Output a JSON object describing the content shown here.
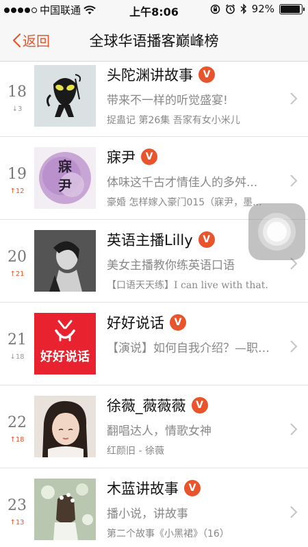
{
  "status": {
    "carrier": "中国联通",
    "time": "上午8:06",
    "battery": "92%",
    "battery_level": 0.92
  },
  "nav": {
    "back_label": "返回",
    "title": "全球华语播客巅峰榜"
  },
  "accent": "#e8542c",
  "items": [
    {
      "rank": "18",
      "trend": "↓3",
      "trend_dir": "down",
      "name": "头陀渊讲故事",
      "desc": "带来不一样的听觉盛宴!",
      "latest": "捉蛊记 第26集 吾家有女小米儿"
    },
    {
      "rank": "19",
      "trend": "↑12",
      "trend_dir": "up",
      "name": "寐尹",
      "desc": "体味这千古才情佳人的多舛...",
      "latest": "豪婚 怎样嫁入豪门015（寐尹，墨..."
    },
    {
      "rank": "20",
      "trend": "↑21",
      "trend_dir": "up",
      "name": "英语主播Lilly",
      "desc": "美女主播教你练英语口语",
      "latest": "【口语天天练】I can live with that."
    },
    {
      "rank": "21",
      "trend": "↓18",
      "trend_dir": "down",
      "name": "好好说话",
      "desc": "【演说】如何自我介绍？—职场...",
      "latest": ""
    },
    {
      "rank": "22",
      "trend": "↑18",
      "trend_dir": "up",
      "name": "徐薇_薇薇薇",
      "desc": "翻唱达人，情歌女神",
      "latest": "红颜旧 - 徐薇"
    },
    {
      "rank": "23",
      "trend": "↑13",
      "trend_dir": "up",
      "name": "木蓝讲故事",
      "desc": "播小说，讲故事",
      "latest": "第二个故事《小黑裙》（16）"
    }
  ],
  "verified_badge": "V",
  "cover_text": {
    "item19": "寐尹",
    "item21": "好好说话"
  }
}
